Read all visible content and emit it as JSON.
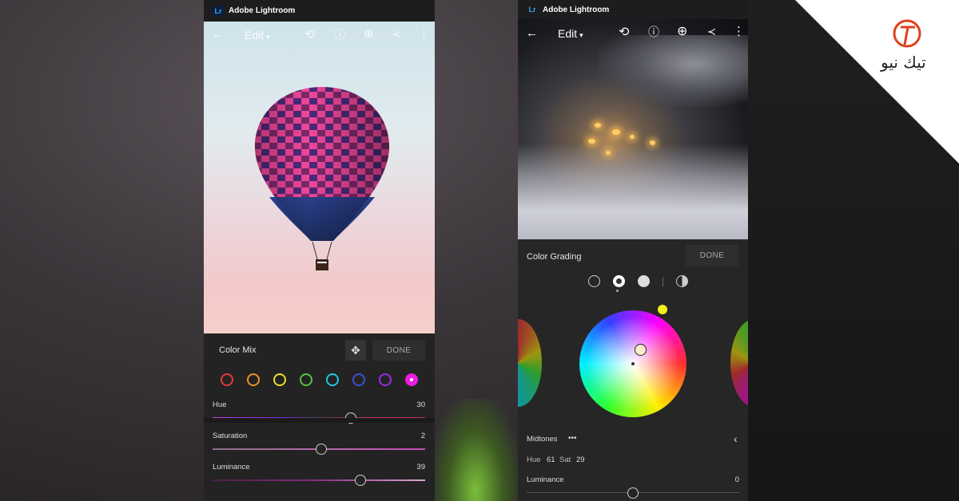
{
  "app_name": "Adobe Lightroom",
  "logo_text": "Lr",
  "toolbar": {
    "edit_label": "Edit",
    "caret": "▾"
  },
  "watermark": {
    "text": "تيك نيو"
  },
  "phone1": {
    "panel_title": "Color Mix",
    "done_label": "DONE",
    "color_dots": [
      "#e53935",
      "#f0902a",
      "#e8e020",
      "#59c240",
      "#1ec8e0",
      "#3d4fd6",
      "#9b2ce0",
      "#e91ee0"
    ],
    "selected_dot_index": 7,
    "sliders": [
      {
        "label": "Hue",
        "value": "30",
        "level": 0.65
      },
      {
        "label": "Saturation",
        "value": "2",
        "level": 0.51
      },
      {
        "label": "Luminance",
        "value": "39",
        "level": 0.695
      }
    ]
  },
  "phone2": {
    "panel_title": "Color Grading",
    "done_label": "DONE",
    "section_label": "Midtones",
    "more_glyph": "•••",
    "hue_label": "Hue",
    "hue_value": "61",
    "sat_label": "Sat",
    "sat_value": "29",
    "luminance_label": "Luminance",
    "luminance_value": "0",
    "luminance_level": 0.5
  },
  "colors": {
    "accent_blue": "#31a8ff",
    "panel_bg": "#242424",
    "selected_magenta": "#e91ee0",
    "wheel_handle": "#f5ef1a"
  }
}
